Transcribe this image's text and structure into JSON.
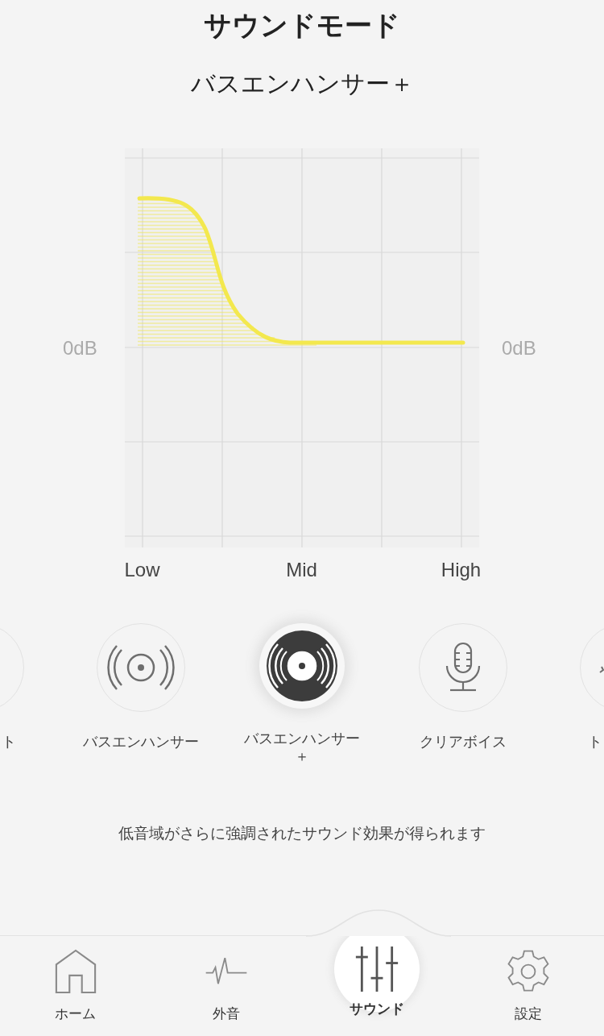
{
  "header": {
    "title": "サウンドモード",
    "subtitle": "バスエンハンサー＋"
  },
  "equalizer": {
    "left_label": "0dB",
    "right_label": "0dB",
    "x_labels": [
      "Low",
      "Mid",
      "High"
    ]
  },
  "modes": [
    {
      "label": "ト",
      "selected": false
    },
    {
      "label": "バスエンハンサー",
      "selected": false
    },
    {
      "label": "バスエンハンサー＋",
      "selected": true
    },
    {
      "label": "クリアボイス",
      "selected": false
    },
    {
      "label": "ト",
      "selected": false
    }
  ],
  "description": "低音域がさらに強調されたサウンド効果が得られます",
  "tabs": [
    {
      "label": "ホーム",
      "selected": false
    },
    {
      "label": "外音",
      "selected": false
    },
    {
      "label": "サウンド",
      "selected": true
    },
    {
      "label": "設定",
      "selected": false
    }
  ]
}
